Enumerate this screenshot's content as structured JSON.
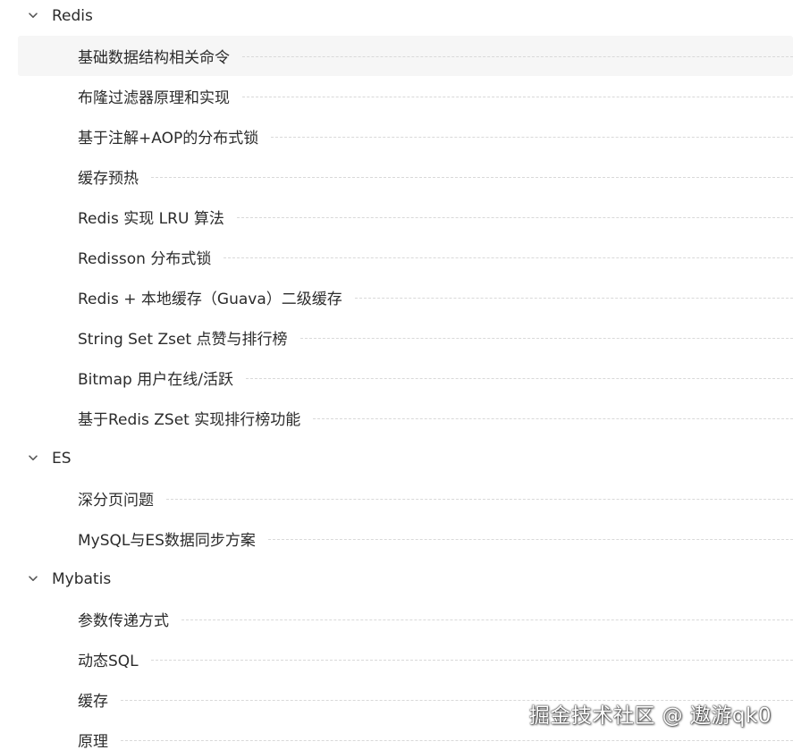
{
  "colors": {
    "text": "#2b2b2b",
    "chevron": "#555555",
    "hover_background": "#f6f6f6",
    "leader_line": "#d9d9d9"
  },
  "icons": {
    "group_toggle": "chevron-down-icon"
  },
  "groups": [
    {
      "label": "Redis",
      "expanded": true,
      "items": [
        "基础数据结构相关命令",
        "布隆过滤器原理和实现",
        "基于注解+AOP的分布式锁",
        "缓存预热",
        "Redis 实现 LRU 算法",
        "Redisson 分布式锁",
        "Redis + 本地缓存（Guava）二级缓存",
        "String Set Zset 点赞与排行榜",
        "Bitmap 用户在线/活跃",
        "基于Redis ZSet 实现排行榜功能"
      ]
    },
    {
      "label": "ES",
      "expanded": true,
      "items": [
        "深分页问题",
        "MySQL与ES数据同步方案"
      ]
    },
    {
      "label": "Mybatis",
      "expanded": true,
      "items": [
        "参数传递方式",
        "动态SQL",
        "缓存",
        "原理"
      ]
    }
  ],
  "highlighted_item": "基础数据结构相关命令",
  "watermark": "掘金技术社区 @ 遨游qk0"
}
